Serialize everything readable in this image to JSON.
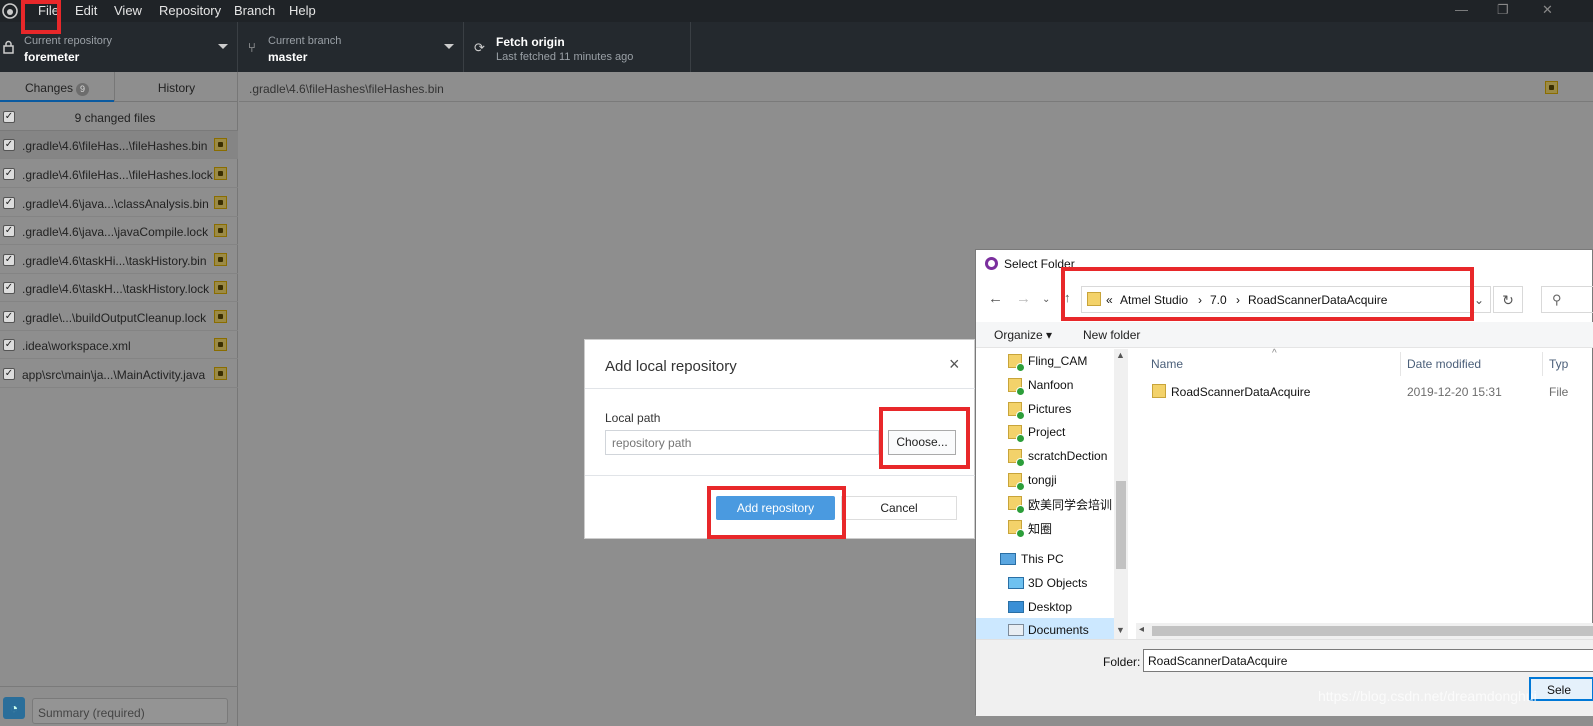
{
  "menubar": {
    "items": [
      "File",
      "Edit",
      "View",
      "Repository",
      "Branch",
      "Help"
    ],
    "window_controls": [
      "—",
      "❐",
      "✕"
    ]
  },
  "toolbar": {
    "repo_label": "Current repository",
    "repo_value": "foremeter",
    "branch_label": "Current branch",
    "branch_value": "master",
    "fetch_label": "Fetch origin",
    "fetch_sub": "Last fetched 11 minutes ago"
  },
  "sidebar": {
    "tab_changes": "Changes",
    "changes_count": "9",
    "tab_history": "History",
    "changed_files_label": "9 changed files",
    "files": [
      ".gradle\\4.6\\fileHas...\\fileHashes.bin",
      ".gradle\\4.6\\fileHas...\\fileHashes.lock",
      ".gradle\\4.6\\java...\\classAnalysis.bin",
      ".gradle\\4.6\\java...\\javaCompile.lock",
      ".gradle\\4.6\\taskHi...\\taskHistory.bin",
      ".gradle\\4.6\\taskH...\\taskHistory.lock",
      ".gradle\\...\\buildOutputCleanup.lock",
      ".idea\\workspace.xml",
      "app\\src\\main\\ja...\\MainActivity.java"
    ],
    "summary_placeholder": "Summary (required)"
  },
  "diff": {
    "path": ".gradle\\4.6\\fileHashes\\fileHashes.bin"
  },
  "add_dialog": {
    "title": "Add local repository",
    "close": "×",
    "field_label": "Local path",
    "path_placeholder": "repository path",
    "choose_label": "Choose...",
    "add_label": "Add repository",
    "cancel_label": "Cancel"
  },
  "folder_dialog": {
    "title": "Select Folder",
    "breadcrumb": [
      "«",
      "Atmel Studio",
      "›",
      "7.0",
      "›",
      "RoadScannerDataAcquire"
    ],
    "organize": "Organize ▾",
    "new_folder": "New folder",
    "tree": [
      {
        "name": "Fling_CAM",
        "kind": "folder"
      },
      {
        "name": "Nanfoon",
        "kind": "folder"
      },
      {
        "name": "Pictures",
        "kind": "folder"
      },
      {
        "name": "Project",
        "kind": "folder"
      },
      {
        "name": "scratchDection",
        "kind": "folder"
      },
      {
        "name": "tongji",
        "kind": "folder"
      },
      {
        "name": "欧美同学会培训",
        "kind": "folder"
      },
      {
        "name": "知圈",
        "kind": "folder"
      },
      {
        "name": "This PC",
        "kind": "pc"
      },
      {
        "name": "3D Objects",
        "kind": "pc-item"
      },
      {
        "name": "Desktop",
        "kind": "pc-item"
      },
      {
        "name": "Documents",
        "kind": "pc-item"
      }
    ],
    "columns": [
      "Name",
      "Date modified",
      "Typ"
    ],
    "rows": [
      {
        "name": "RoadScannerDataAcquire",
        "date": "2019-12-20 15:31",
        "type": "File"
      }
    ],
    "folder_label": "Folder:",
    "folder_value": "RoadScannerDataAcquire",
    "select_label": "Sele"
  },
  "watermark": "https://blog.csdn.net/dreamdonghui"
}
